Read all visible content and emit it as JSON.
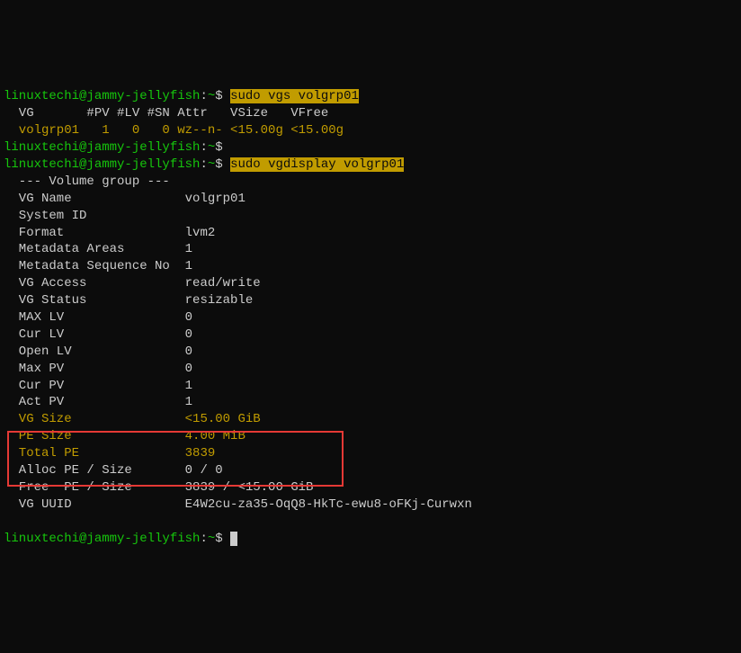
{
  "prompt1": {
    "user": "linuxtechi@jammy-jellyfish",
    "sep": ":",
    "path": "~",
    "dollar": "$",
    "cmd": "sudo vgs volgrp01"
  },
  "vgs": {
    "header": "  VG       #PV #LV #SN Attr   VSize   VFree",
    "row": "  volgrp01   1   0   0 wz--n- <15.00g <15.00g"
  },
  "prompt2": {
    "user": "linuxtechi@jammy-jellyfish",
    "sep": ":",
    "path": "~",
    "dollar": "$"
  },
  "prompt3": {
    "user": "linuxtechi@jammy-jellyfish",
    "sep": ":",
    "path": "~",
    "dollar": "$",
    "cmd": "sudo vgdisplay volgrp01"
  },
  "vgdisplay": {
    "header": "  --- Volume group ---",
    "rows": [
      {
        "label": "  VG Name              ",
        "value": " volgrp01"
      },
      {
        "label": "  System ID",
        "value": ""
      },
      {
        "label": "  Format               ",
        "value": " lvm2"
      },
      {
        "label": "  Metadata Areas       ",
        "value": " 1"
      },
      {
        "label": "  Metadata Sequence No ",
        "value": " 1"
      },
      {
        "label": "  VG Access            ",
        "value": " read/write"
      },
      {
        "label": "  VG Status            ",
        "value": " resizable"
      },
      {
        "label": "  MAX LV               ",
        "value": " 0"
      },
      {
        "label": "  Cur LV               ",
        "value": " 0"
      },
      {
        "label": "  Open LV              ",
        "value": " 0"
      },
      {
        "label": "  Max PV               ",
        "value": " 0"
      },
      {
        "label": "  Cur PV               ",
        "value": " 1"
      },
      {
        "label": "  Act PV               ",
        "value": " 1"
      }
    ],
    "highlighted_rows": [
      {
        "label": "  VG Size              ",
        "value": " <15.00 GiB"
      },
      {
        "label": "  PE Size              ",
        "value": " 4.00 MiB"
      },
      {
        "label": "  Total PE             ",
        "value": " 3839"
      }
    ],
    "rows_after": [
      {
        "label": "  Alloc PE / Size      ",
        "value": " 0 / 0"
      },
      {
        "label": "  Free  PE / Size      ",
        "value": " 3839 / <15.00 GiB"
      },
      {
        "label": "  VG UUID              ",
        "value": " E4W2cu-za35-OqQ8-HkTc-ewu8-oFKj-Curwxn"
      }
    ]
  },
  "prompt4": {
    "user": "linuxtechi@jammy-jellyfish",
    "sep": ":",
    "path": "~",
    "dollar": "$"
  }
}
